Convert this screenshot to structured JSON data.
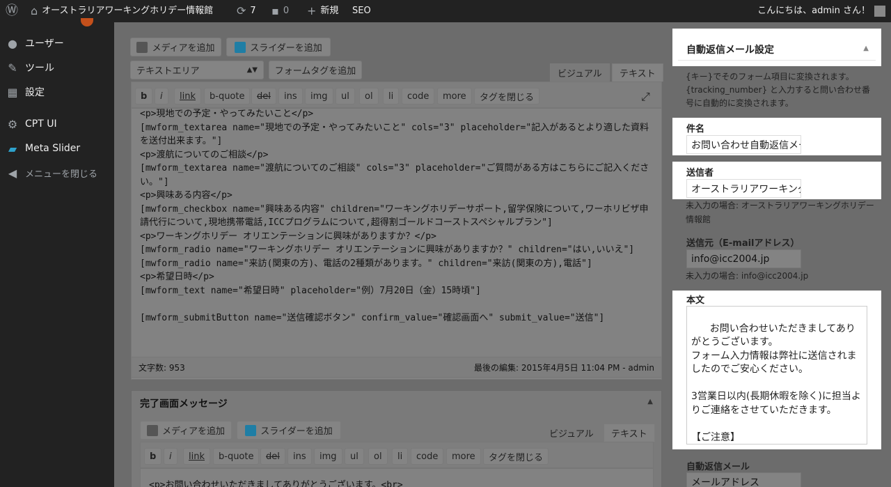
{
  "adminbar": {
    "site_name": "オーストラリアワーキングホリデー情報館",
    "updates_count": "7",
    "comments_count": "0",
    "new_label": "新規",
    "seo_label": "SEO",
    "greeting": "こんにちは、admin さん！"
  },
  "sidebar": {
    "items": [
      {
        "label": "ユーザー",
        "icon": "user-icon"
      },
      {
        "label": "ツール",
        "icon": "wrench-icon"
      },
      {
        "label": "設定",
        "icon": "settings-icon"
      },
      {
        "label": "CPT UI",
        "icon": "gear-icon"
      },
      {
        "label": "Meta Slider",
        "icon": "image-icon"
      },
      {
        "label": "メニューを閉じる",
        "icon": "collapse-icon"
      }
    ]
  },
  "editor": {
    "add_media": "メディアを追加",
    "add_slider": "スライダーを追加",
    "select_value": "テキストエリア",
    "form_tag_button": "フォームタグを追加",
    "tab_visual": "ビジュアル",
    "tab_text": "テキスト",
    "quicktags": [
      "b",
      "i",
      "link",
      "b-quote",
      "del",
      "ins",
      "img",
      "ul",
      "ol",
      "li",
      "code",
      "more",
      "タグを閉じる"
    ],
    "content": "<p>現地での予定・やってみたいこと</p>\n[mwform_textarea name=\"現地での予定・やってみたいこと\" cols=\"3\" placeholder=\"記入があるとより適した資料を送付出来ます。\"]\n<p>渡航についてのご相談</p>\n[mwform_textarea name=\"渡航についてのご相談\" cols=\"3\" placeholder=\"ご質問がある方はこちらにご記入ください。\"]\n<p>興味ある内容</p>\n[mwform_checkbox name=\"興味ある内容\" children=\"ワーキングホリデーサポート,留学保険について,ワーホリビザ申請代行について,現地携帯電話,ICCプログラムについて,超得割ゴールドコーストスペシャルプラン\"]\n<p>ワーキングホリデー オリエンテーションに興味がありますか？</p>\n[mwform_radio name=\"ワーキングホリデー オリエンテーションに興味がありますか？\" children=\"はい,いいえ\"]\n[mwform_radio name=\"来訪(関東の方)、電話の2種類があります。\" children=\"来訪(関東の方),電話\"]\n<p>希望日時</p>\n[mwform_text name=\"希望日時\" placeholder=\"例）7月20日（金）15時頃\"]\n\n[mwform_submitButton name=\"送信確認ボタン\" confirm_value=\"確認画面へ\" submit_value=\"送信\"]",
    "word_count": "文字数: 953",
    "last_edit": "最後の編集: 2015年4月5日 11:04 PM - admin"
  },
  "complete_panel": {
    "title": "完了画面メッセージ",
    "add_media": "メディアを追加",
    "add_slider": "スライダーを追加",
    "tab_visual": "ビジュアル",
    "tab_text": "テキスト",
    "quicktags": [
      "b",
      "i",
      "link",
      "b-quote",
      "del",
      "ins",
      "img",
      "ul",
      "ol",
      "li",
      "code",
      "more",
      "タグを閉じる"
    ],
    "content_line": "<p>お問い合わせいただきましてありがとうございます。<br>"
  },
  "autoreply": {
    "title": "自動返信メール設定",
    "description": "{キー}でそのフォーム項目に変換されます。 {tracking_number} と入力すると問い合わせ番号に自動的に変換されます。",
    "subject_label": "件名",
    "subject_value": "お問い合わせ自動返信メール",
    "sender_label": "送信者",
    "sender_value": "オーストラリアワーキングホリデー情報館",
    "sender_note": "未入力の場合: オーストラリアワーキングホリデー情報館",
    "from_label": "送信元（E-mailアドレス）",
    "from_value": "info@icc2004.jp",
    "from_note": "未入力の場合: info@icc2004.jp",
    "body_label": "本文",
    "body_value": "お問い合わせいただきましてありがとうございます。\nフォーム入力情報は弊社に送信されましたのでご安心ください。\n\n3営業日以内(長期休暇を除く)に担当よりご連絡をさせていただきます。\n\n【ご注意】\nGmailやYahooのフリーメールをお使",
    "autoreply_label": "自動返信メール",
    "autoreply_value": "メールアドレス"
  }
}
